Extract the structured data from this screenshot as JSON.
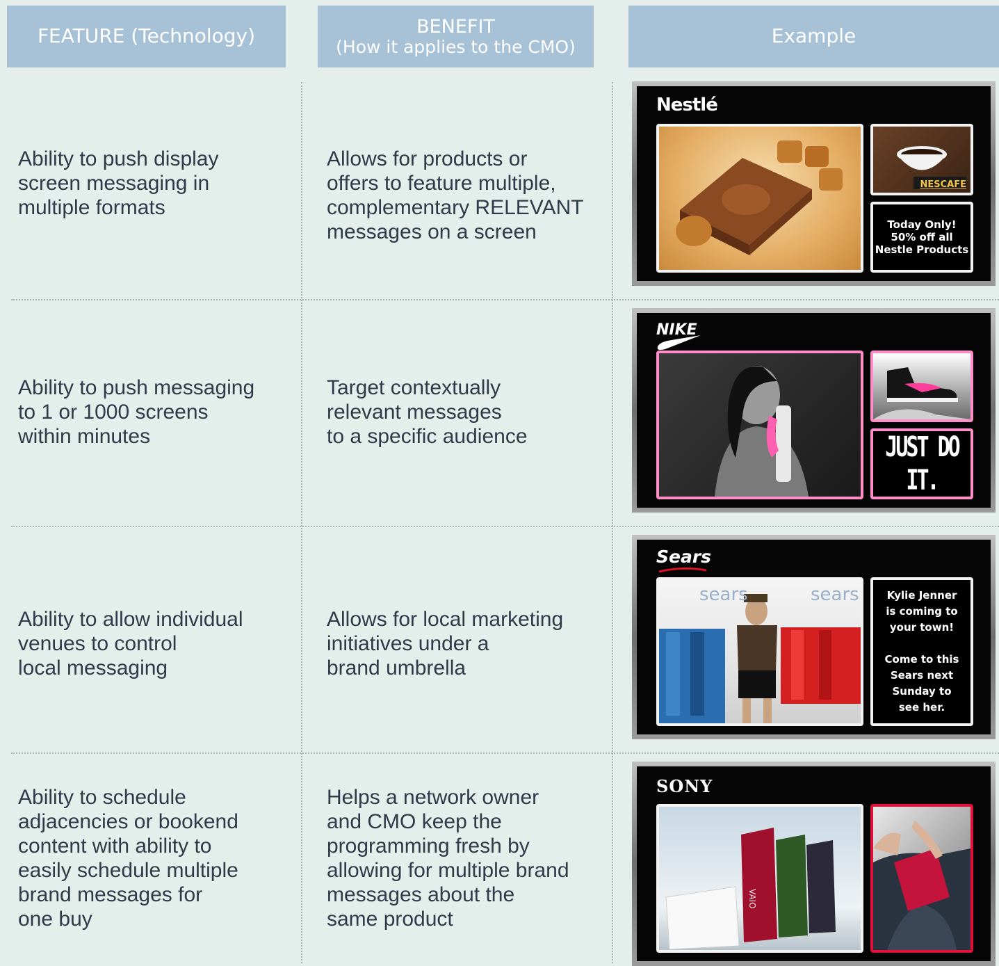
{
  "headers": {
    "feature": "FEATURE (Technology)",
    "benefit_line1": "BENEFIT",
    "benefit_line2": "(How it applies to the CMO)",
    "example": "Example"
  },
  "rows": [
    {
      "feature": [
        "Ability to push display",
        "screen messaging in",
        "multiple formats"
      ],
      "benefit": [
        "Allows for products or",
        "offers to feature multiple,",
        "complementary RELEVANT",
        "messages on a screen"
      ],
      "example": {
        "brand": "Nestlé",
        "sub_brand": "NESCAFE",
        "side_text": [
          "Today Only!",
          "50% off all",
          "Nestle Products"
        ]
      }
    },
    {
      "feature": [
        "Ability to push messaging",
        "to 1 or 1000 screens",
        "within minutes"
      ],
      "benefit": [
        "Target contextually",
        "relevant messages",
        "to a specific audience"
      ],
      "example": {
        "brand": "NIKE",
        "side_text": [
          "JUST DO IT."
        ]
      }
    },
    {
      "feature": [
        "Ability to allow individual",
        "venues to control",
        "local messaging"
      ],
      "benefit": [
        "Allows for local marketing",
        "initiatives under a",
        "brand umbrella"
      ],
      "example": {
        "brand": "Sears",
        "photo_sign_left": "sears",
        "photo_sign_right": "sears",
        "side_text": [
          "Kylie Jenner",
          "is coming to",
          "your town!",
          "",
          "Come to this",
          "Sears next",
          "Sunday to",
          "see her."
        ]
      }
    },
    {
      "feature": [
        "Ability to schedule",
        "adjacencies or bookend",
        "content with ability to",
        "easily schedule multiple",
        "brand messages for",
        "one buy"
      ],
      "benefit": [
        "Helps a network owner",
        "and CMO keep the",
        "programming fresh by",
        "allowing for multiple brand",
        "messages about the",
        "same product"
      ],
      "example": {
        "brand": "SONY",
        "product_mark": "VAIO"
      }
    }
  ],
  "colors": {
    "background": "#e4eeea",
    "header_bg": "#a7c2d7",
    "header_text": "#ffffff",
    "body_text": "#2e3a4a",
    "divider": "#a8b0b0"
  }
}
